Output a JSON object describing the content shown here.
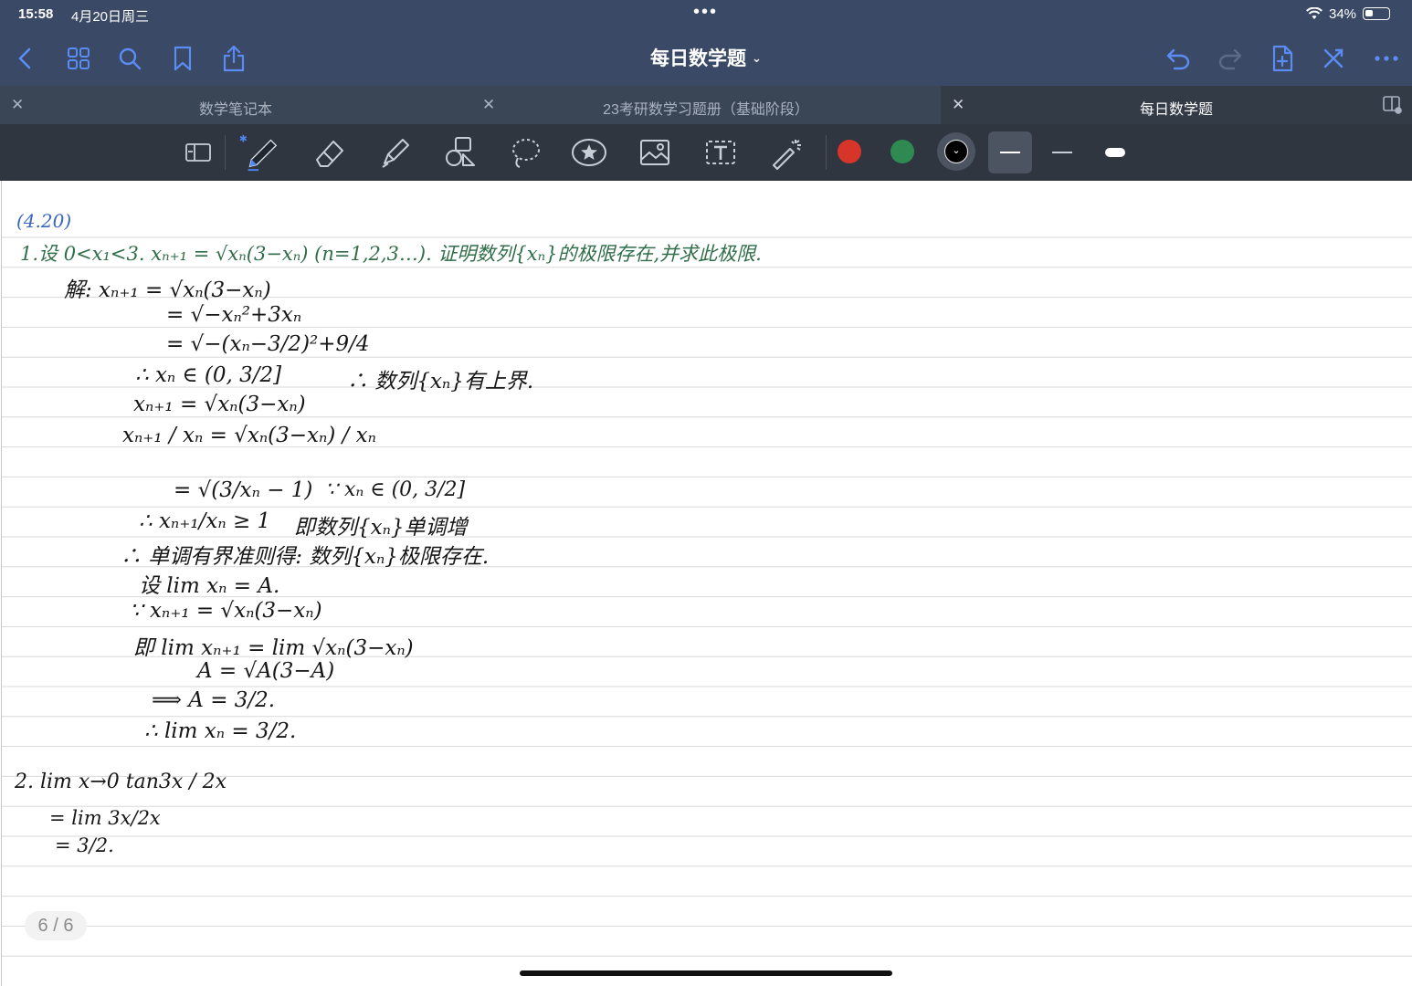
{
  "status_bar": {
    "time": "15:58",
    "date": "4月20日周三",
    "battery_text": "34%",
    "battery_level": 0.34
  },
  "nav": {
    "doc_title": "每日数学题"
  },
  "tabs": [
    {
      "label": "数学笔记本",
      "active": false
    },
    {
      "label": "23考研数学习题册（基础阶段）",
      "active": false
    },
    {
      "label": "每日数学题",
      "active": true
    }
  ],
  "toolbar": {
    "tools": [
      "layout-icon",
      "pen-icon",
      "eraser-icon",
      "highlighter-icon",
      "shapes-icon",
      "lasso-icon",
      "sticker-icon",
      "image-icon",
      "textbox-icon",
      "laser-pointer-icon"
    ],
    "colors": [
      "#d7342a",
      "#2f8a52",
      "#000000"
    ],
    "selected_color": "#000000",
    "stroke_widths": [
      "thin",
      "medium",
      "thick"
    ],
    "selected_stroke": "thin"
  },
  "note": {
    "lines": [
      "(4.20)",
      "1.设 0<x₁<3.  xₙ₊₁ = √xₙ(3−xₙ)  (n=1,2,3…). 证明数列{xₙ}的极限存在,并求此极限.",
      "解:  xₙ₊₁ = √xₙ(3−xₙ)",
      "= √−xₙ²+3xₙ",
      "= √−(xₙ−3/2)²+9/4",
      "∴ xₙ ∈ (0, 3/2]",
      "∴ 数列{xₙ}有上界.",
      "xₙ₊₁ = √xₙ(3−xₙ)",
      "xₙ₊₁ / xₙ = √xₙ(3−xₙ) / xₙ",
      "= √(3/xₙ − 1)",
      "∵ xₙ ∈ (0, 3/2]",
      "∴ xₙ₊₁/xₙ ≥ 1",
      "即数列{xₙ}单调增",
      "∴ 单调有界准则得: 数列{xₙ}极限存在.",
      "设 lim xₙ = A.",
      "∵ xₙ₊₁ = √xₙ(3−xₙ)",
      "即 lim xₙ₊₁ = lim √xₙ(3−xₙ)",
      "A = √A(3−A)",
      "⟹ A = 3/2.",
      "∴ lim xₙ = 3/2.",
      "2. lim x→0 tan3x / 2x",
      "= lim 3x/2x",
      "= 3/2."
    ],
    "page_indicator": "6 / 6"
  }
}
